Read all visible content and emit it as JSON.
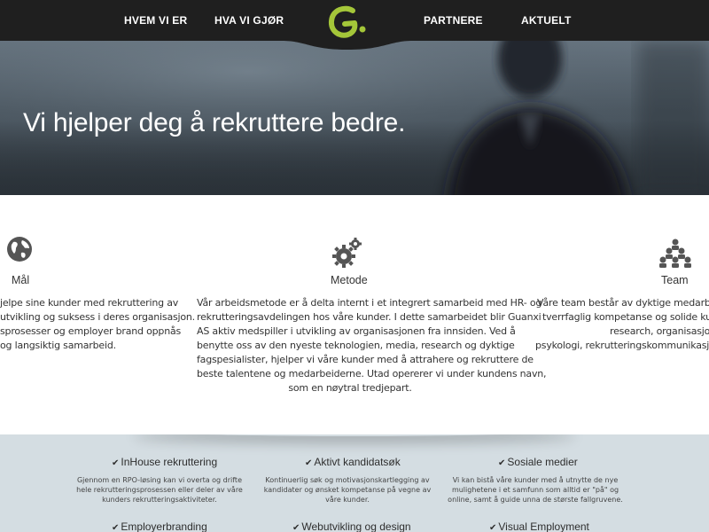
{
  "nav": {
    "items": [
      "HVEM VI ER",
      "HVA VI GJØR",
      "PARTNERE",
      "AKTUELT"
    ],
    "logo_icon": "guanxi-g-logo"
  },
  "hero": {
    "title": "Vi hjelper deg å rekruttere bedre."
  },
  "features": [
    {
      "icon": "globe-icon",
      "title": "Mål",
      "lines": [
        "jelpe sine kunder med rekruttering av",
        "utvikling og suksess i deres organisasjon.",
        "sprosesser og employer brand oppnås",
        "og langsiktig samarbeid."
      ]
    },
    {
      "icon": "gears-icon",
      "title": "Metode",
      "lines": [
        "Vår arbeidsmetode er å delta internt i et integrert samarbeid med HR- og",
        "rekrutteringsavdelingen hos våre kunder. I dette samarbeidet blir Guanxi",
        "AS aktiv medspiller i utvikling av organisasjonen fra innsiden. Ved å",
        "benytte oss av den nyeste teknologien, media, research og dyktige",
        "fagspesialister, hjelper vi våre kunder med å attrahere og rekruttere de",
        "beste talentene og medarbeiderne. Utad opererer vi under kundens navn,",
        "som en nøytral tredjepart."
      ]
    },
    {
      "icon": "team-icon",
      "title": "Team",
      "lines": [
        "Våre team består av dyktige medarbeidere",
        "tverrfaglig kompetanse og solide kunnskap",
        "research, organisasjonsu",
        "psykologi, rekrutteringskommunikasjon, web"
      ]
    }
  ],
  "services": [
    {
      "title": "InHouse rekruttering",
      "lines": [
        "Gjennom en RPO-løsing kan vi overta  og drifte",
        "hele rekrutteringsprosessen eller deler av  våre",
        "kunders rekrutteringsaktiviteter."
      ]
    },
    {
      "title": "Aktivt kandidatsøk",
      "lines": [
        "Kontinuerlig søk og motivasjonskartlegging av",
        "kandidater og ønsket kompetanse på vegne av",
        "våre kunder."
      ]
    },
    {
      "title": "Sosiale medier",
      "lines": [
        "Vi kan bistå våre kunder med å utnytte de nye",
        "mulighetene i et samfunn som alltid er \"på\" og",
        "online, samt å guide unna de største fallgruvene."
      ]
    },
    {
      "title": "Employerbranding",
      "lines": []
    },
    {
      "title": "Webutvikling og design",
      "lines": []
    },
    {
      "title": "Visual Employment",
      "lines": []
    }
  ],
  "colors": {
    "nav_bg": "#1f1f1f",
    "logo_green": "#a4c639",
    "band_bg": "#d4dde2",
    "icon_gray": "#555555"
  }
}
